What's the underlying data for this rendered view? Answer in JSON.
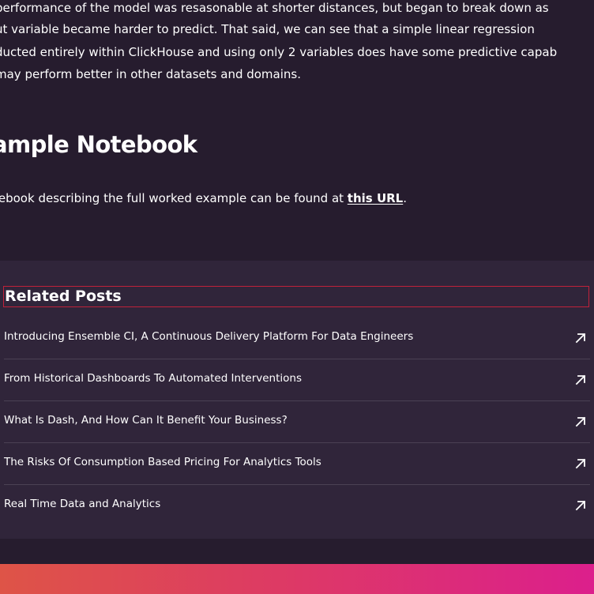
{
  "article": {
    "paragraph_lines": [
      "performance of the model was resasonable at shorter distances, but began to break down as",
      "ut variable became harder to predict. That said, we can see that a simple linear regression",
      "ducted entirely within ClickHouse and using only 2 variables does have some predictive capab",
      "may perform better in other datasets and domains."
    ],
    "heading": "ample Notebook",
    "notebook_text": "tebook describing the full worked example can be found at ",
    "notebook_link": "this URL",
    "notebook_suffix": "."
  },
  "related": {
    "title": "Related Posts",
    "posts": [
      {
        "label": "Introducing Ensemble CI, A Continuous Delivery Platform For Data Engineers",
        "icon": "arrow-up-right-icon"
      },
      {
        "label": "From Historical Dashboards To Automated Interventions",
        "icon": "arrow-up-right-icon"
      },
      {
        "label": "What Is Dash, And How Can It Benefit Your Business?",
        "icon": "arrow-up-right-icon"
      },
      {
        "label": "The Risks Of Consumption Based Pricing For Analytics Tools",
        "icon": "arrow-up-right-icon"
      },
      {
        "label": "Real Time Data and Analytics",
        "icon": "arrow-up-right-icon"
      }
    ]
  },
  "colors": {
    "background": "#261c2e",
    "related_background": "#30253a",
    "highlight_border": "#c0213a",
    "gradient_start": "#de5447",
    "gradient_end": "#dc1f8c"
  }
}
